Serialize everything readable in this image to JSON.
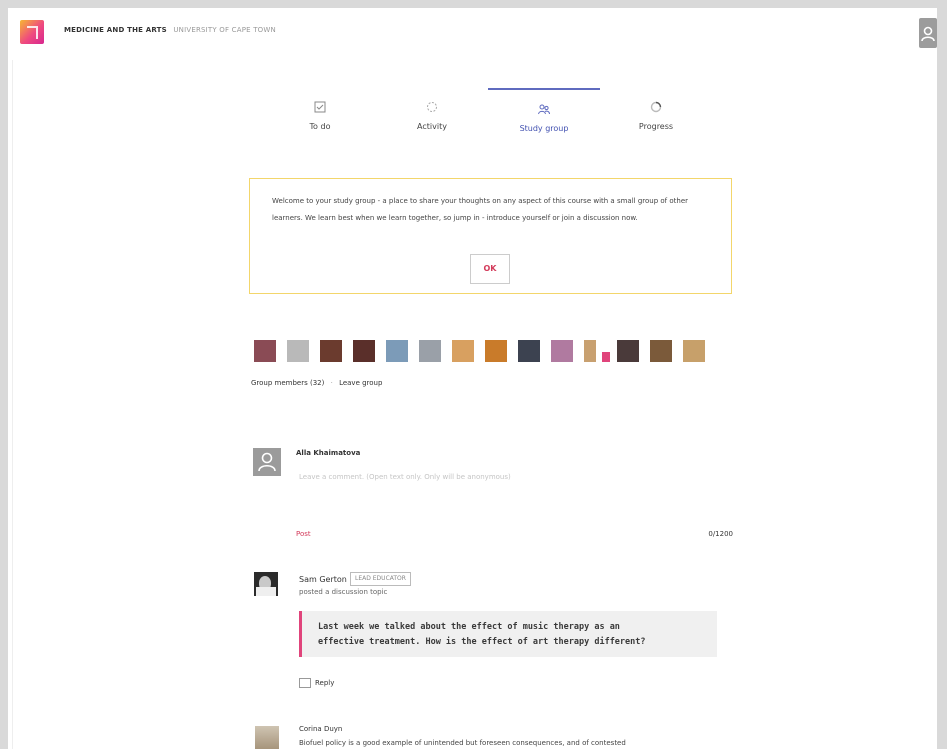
{
  "header": {
    "course": "MEDICINE AND THE ARTS",
    "university": "UNIVERSITY OF CAPE TOWN"
  },
  "tabs": [
    {
      "label": "To do",
      "icon": "todo-icon"
    },
    {
      "label": "Activity",
      "icon": "activity-icon"
    },
    {
      "label": "Study group",
      "icon": "study-group-icon",
      "active": true
    },
    {
      "label": "Progress",
      "icon": "progress-icon"
    }
  ],
  "banner": {
    "text": "Welcome to your study group - a place to share your thoughts on any aspect of this course with a small group of other learners. We learn best when we learn together, so jump in - introduce yourself or join a discussion now.",
    "ok_label": "OK"
  },
  "group": {
    "members_label": "Group members (32)",
    "separator": "·",
    "leave_label": "Leave group",
    "avatar_colors": [
      "#8a4b55",
      "#b9b9b9",
      "#6b3b2e",
      "#5a2f2a",
      "#7c9bb8",
      "#9aa0a8",
      "#d8a060",
      "#c97b2a",
      "#3c4250",
      "#b07aa0",
      "#c8a070",
      "#4a3a3a",
      "#7b5a3a",
      "#c7a06a"
    ]
  },
  "composer": {
    "user_name": "Alla Khaimatova",
    "placeholder": "Leave a comment. (Open text only. Only will be anonymous)",
    "post_label": "Post",
    "char_count": "0/1200"
  },
  "posts": [
    {
      "author": "Sam Gerton",
      "badge": "LEAD EDUCATOR",
      "action": "posted a discussion topic",
      "text_line1": "Last week we talked about the effect of music therapy as an",
      "text_line2": "effective treatment. How is the effect of art therapy different?",
      "reply_label": "Reply"
    },
    {
      "author": "Corina Duyn",
      "text": "Biofuel policy is a good example of unintended but foreseen consequences, and of contested"
    }
  ],
  "colors": {
    "accent": "#d33a5a",
    "tab_active": "#5f6bbf",
    "banner_border": "#f3d66b"
  }
}
